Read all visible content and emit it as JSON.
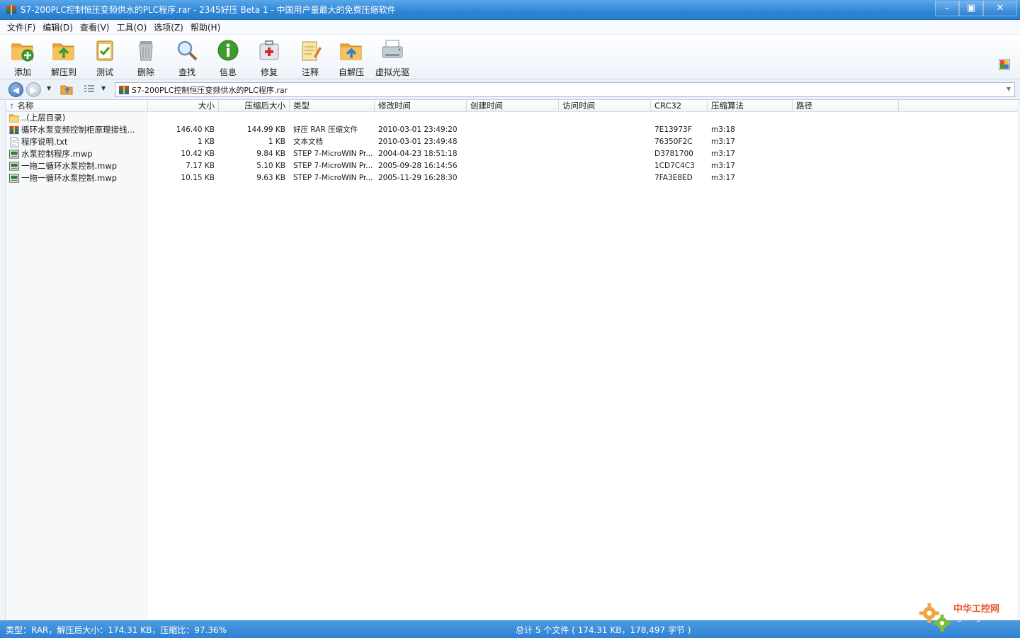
{
  "window": {
    "title": "S7-200PLC控制恒压变频供水的PLC程序.rar - 2345好压 Beta 1 - 中国用户量最大的免费压缩软件",
    "controls": {
      "minimize": "–",
      "maximize": "▣",
      "close": "✕"
    }
  },
  "menu": [
    "文件(F)",
    "编辑(D)",
    "查看(V)",
    "工具(O)",
    "选项(Z)",
    "帮助(H)"
  ],
  "toolbar": [
    {
      "label": "添加",
      "icon": "add-folder-icon"
    },
    {
      "label": "解压到",
      "icon": "extract-folder-icon"
    },
    {
      "label": "测试",
      "icon": "test-clipboard-icon"
    },
    {
      "label": "删除",
      "icon": "trash-icon"
    },
    {
      "label": "查找",
      "icon": "magnifier-icon"
    },
    {
      "label": "信息",
      "icon": "info-icon"
    },
    {
      "label": "修复",
      "icon": "first-aid-icon"
    },
    {
      "label": "注释",
      "icon": "note-icon"
    },
    {
      "label": "自解压",
      "icon": "self-extract-icon"
    },
    {
      "label": "虚拟光驱",
      "icon": "virtual-drive-icon"
    }
  ],
  "address": {
    "path": "S7-200PLC控制恒压变频供水的PLC程序.rar",
    "icons": {
      "back": "◀",
      "forward": "▶",
      "dropdown": "▼"
    }
  },
  "columns": [
    "名称",
    "大小",
    "压缩后大小",
    "类型",
    "修改时间",
    "创建时间",
    "访问时间",
    "CRC32",
    "压缩算法",
    "路径"
  ],
  "sort_indicator": "↑",
  "files": [
    {
      "icon": "parent-folder-icon",
      "name": "..(上层目录)",
      "size": "",
      "packed": "",
      "type": "",
      "modified": "",
      "created": "",
      "accessed": "",
      "crc": "",
      "method": "",
      "path": ""
    },
    {
      "icon": "rar-icon",
      "name": "循环水泵变频控制柜原理接线...",
      "size": "146.40 KB",
      "packed": "144.99 KB",
      "type": "好压 RAR 压缩文件",
      "modified": "2010-03-01 23:49:20",
      "created": "",
      "accessed": "",
      "crc": "7E13973F",
      "method": "m3:18",
      "path": ""
    },
    {
      "icon": "text-file-icon",
      "name": "程序说明.txt",
      "size": "1 KB",
      "packed": "1 KB",
      "type": "文本文档",
      "modified": "2010-03-01 23:49:48",
      "created": "",
      "accessed": "",
      "crc": "76350F2C",
      "method": "m3:17",
      "path": ""
    },
    {
      "icon": "mwp-file-icon",
      "name": "水泵控制程序.mwp",
      "size": "10.42 KB",
      "packed": "9.84 KB",
      "type": "STEP 7-MicroWIN Pr...",
      "modified": "2004-04-23 18:51:18",
      "created": "",
      "accessed": "",
      "crc": "D3781700",
      "method": "m3:17",
      "path": ""
    },
    {
      "icon": "mwp-file-icon",
      "name": "一拖二循环水泵控制.mwp",
      "size": "7.17 KB",
      "packed": "5.10 KB",
      "type": "STEP 7-MicroWIN Pr...",
      "modified": "2005-09-28 16:14:56",
      "created": "",
      "accessed": "",
      "crc": "1CD7C4C3",
      "method": "m3:17",
      "path": ""
    },
    {
      "icon": "mwp-file-icon",
      "name": "一拖一循环水泵控制.mwp",
      "size": "10.15 KB",
      "packed": "9.63 KB",
      "type": "STEP 7-MicroWIN Pr...",
      "modified": "2005-11-29 16:28:30",
      "created": "",
      "accessed": "",
      "crc": "7FA3E8ED",
      "method": "m3:17",
      "path": ""
    }
  ],
  "status": {
    "left": "类型：RAR，解压后大小：174.31 KB，压缩比：97.36%",
    "center": "总计 5 个文件 ( 174.31 KB，178,497 字节 )"
  },
  "watermark": {
    "brand": "中华工控网",
    "domain": "gkong.com"
  },
  "colors": {
    "titlebar": "#2f86d6",
    "statusbar": "#3a8bd8",
    "accent": "#2a7ccc"
  }
}
